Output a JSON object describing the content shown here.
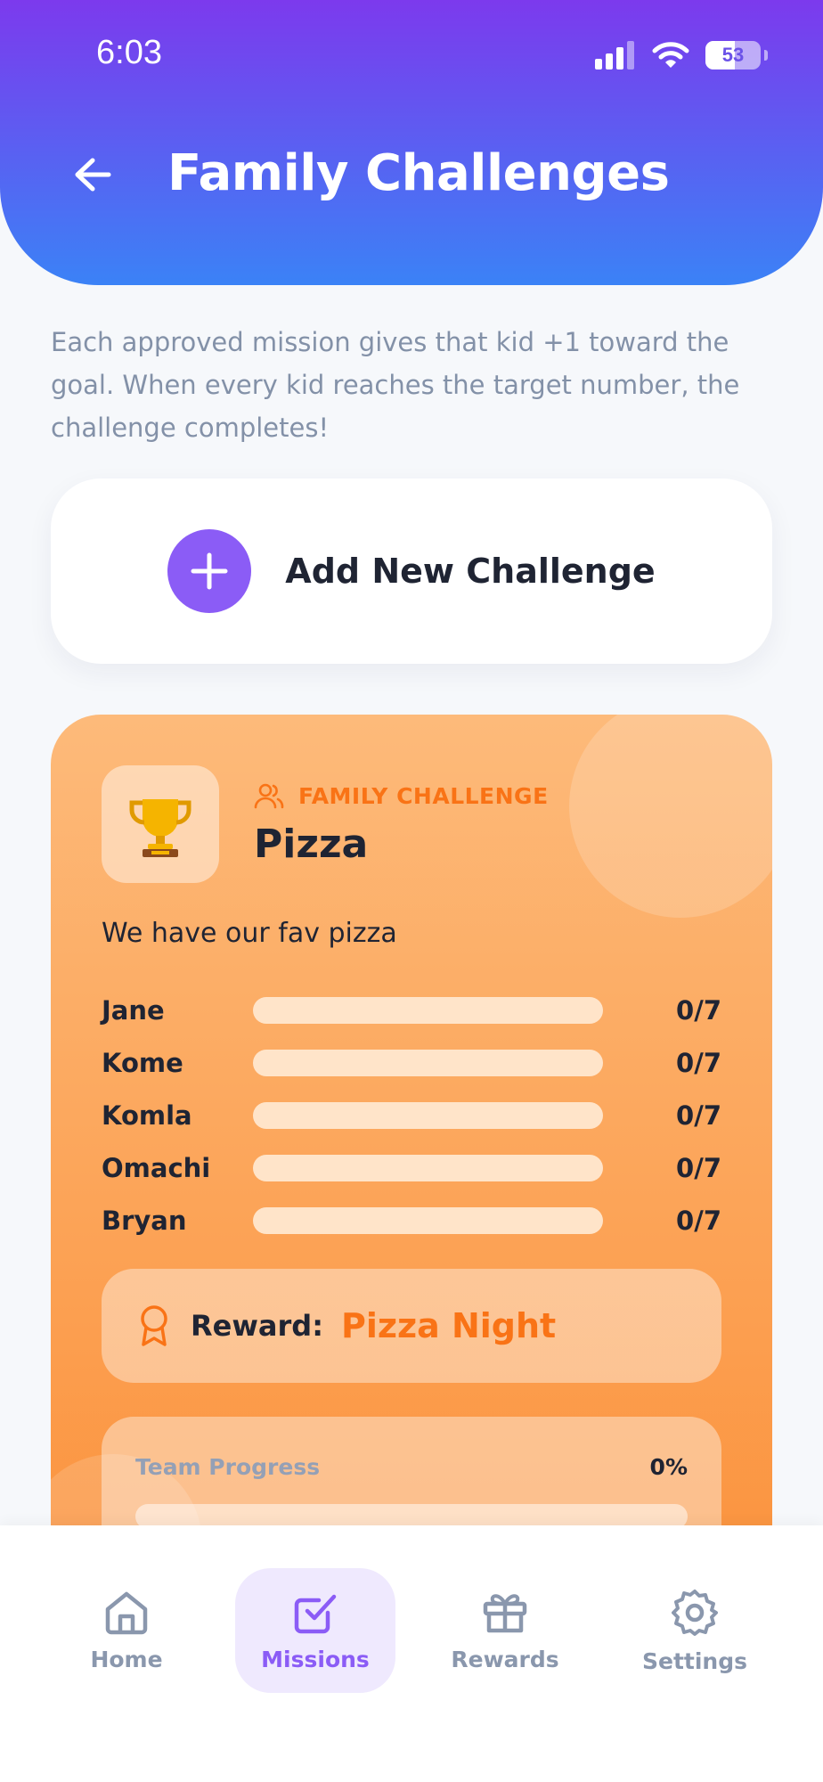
{
  "status_bar": {
    "time": "6:03",
    "battery": "53",
    "battery_level": 0.53
  },
  "header": {
    "title": "Family Challenges",
    "back_icon": "arrow-left-icon"
  },
  "intro_text": "Each approved mission gives that kid +1 toward the goal. When every kid reaches the target number, the challenge completes!",
  "add_challenge": {
    "label": "Add New Challenge",
    "icon": "plus-icon"
  },
  "challenge": {
    "type_label": "FAMILY CHALLENGE",
    "title": "Pizza",
    "description": "We have our fav pizza",
    "icon": "trophy-icon",
    "members": [
      {
        "name": "Jane",
        "count": "0/7",
        "progress": 0
      },
      {
        "name": "Kome",
        "count": "0/7",
        "progress": 0
      },
      {
        "name": "Komla",
        "count": "0/7",
        "progress": 0
      },
      {
        "name": "Omachi",
        "count": "0/7",
        "progress": 0
      },
      {
        "name": "Bryan",
        "count": "0/7",
        "progress": 0
      }
    ],
    "reward_label": "Reward:",
    "reward_value": "Pizza Night",
    "team_progress_label": "Team Progress",
    "team_progress_value": "0%",
    "team_progress": 0
  },
  "nav": [
    {
      "label": "Home",
      "icon": "home-icon",
      "active": false
    },
    {
      "label": "Missions",
      "icon": "checkbox-icon",
      "active": true
    },
    {
      "label": "Rewards",
      "icon": "gift-icon",
      "active": false
    },
    {
      "label": "Settings",
      "icon": "gear-icon",
      "active": false
    }
  ],
  "colors": {
    "header_gradient_start": "#7c3aed",
    "header_gradient_end": "#3b82f6",
    "accent_purple": "#8b5cf6",
    "accent_orange": "#f97316",
    "card_orange": "#fdba7a"
  }
}
